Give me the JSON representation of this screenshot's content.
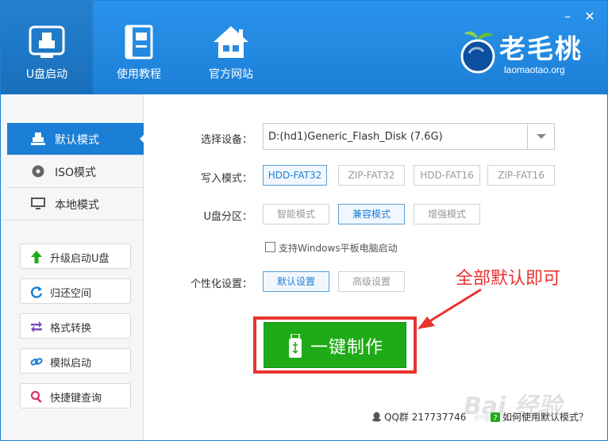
{
  "header": {
    "nav": [
      {
        "label": "U盘启动",
        "icon": "usb-drive-icon"
      },
      {
        "label": "使用教程",
        "icon": "book-icon"
      },
      {
        "label": "官方网站",
        "icon": "home-icon"
      }
    ],
    "window_controls": {
      "minimize": "–",
      "close": "✕"
    },
    "logo": {
      "name": "老毛桃",
      "site": "laomaotao.org"
    }
  },
  "sidebar": {
    "modes": [
      {
        "label": "默认模式",
        "icon": "usb-drive-icon",
        "active": true
      },
      {
        "label": "ISO模式",
        "icon": "disc-icon",
        "active": false
      },
      {
        "label": "本地模式",
        "icon": "monitor-icon",
        "active": false
      }
    ],
    "tools": [
      {
        "label": "升级启动U盘",
        "icon": "arrow-up-icon"
      },
      {
        "label": "归还空间",
        "icon": "refresh-icon"
      },
      {
        "label": "格式转换",
        "icon": "swap-icon"
      },
      {
        "label": "模拟启动",
        "icon": "link-icon"
      },
      {
        "label": "快捷键查询",
        "icon": "search-icon"
      }
    ]
  },
  "main": {
    "device": {
      "label": "选择设备：",
      "value": "D:(hd1)Generic_Flash_Disk (7.6G)"
    },
    "write_mode": {
      "label": "写入模式：",
      "options": [
        "HDD-FAT32",
        "ZIP-FAT32",
        "HDD-FAT16",
        "ZIP-FAT16"
      ],
      "selected": "HDD-FAT32"
    },
    "partition": {
      "label": "U盘分区：",
      "options": [
        "智能模式",
        "兼容模式",
        "增强模式"
      ],
      "selected": "兼容模式"
    },
    "tablet_checkbox": {
      "label": "支持Windows平板电脑启动",
      "checked": false
    },
    "personalize": {
      "label": "个性化设置：",
      "options": [
        "默认设置",
        "高级设置"
      ],
      "selected": "默认设置"
    },
    "make_button": "一键制作",
    "annotation": "全部默认即可",
    "footer": {
      "qq": "QQ群 217737746",
      "help": "如何使用默认模式？"
    },
    "watermark": {
      "text": "Bai 经验",
      "sub": "jingyan.baidu.com"
    }
  },
  "colors": {
    "header": "#1c7fd6",
    "accent": "#1c7fd6",
    "make_button": "#1fab17",
    "annotation": "#e8332f"
  }
}
